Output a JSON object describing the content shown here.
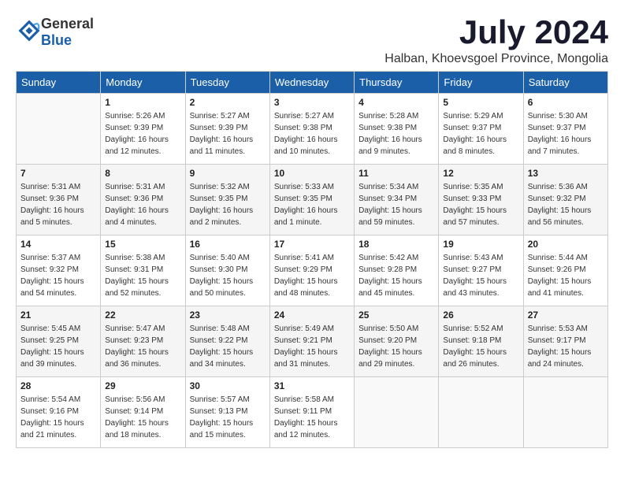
{
  "logo": {
    "general": "General",
    "blue": "Blue"
  },
  "title": "July 2024",
  "subtitle": "Halban, Khoevsgoel Province, Mongolia",
  "days_of_week": [
    "Sunday",
    "Monday",
    "Tuesday",
    "Wednesday",
    "Thursday",
    "Friday",
    "Saturday"
  ],
  "weeks": [
    [
      {
        "day": "",
        "info": ""
      },
      {
        "day": "1",
        "info": "Sunrise: 5:26 AM\nSunset: 9:39 PM\nDaylight: 16 hours\nand 12 minutes."
      },
      {
        "day": "2",
        "info": "Sunrise: 5:27 AM\nSunset: 9:39 PM\nDaylight: 16 hours\nand 11 minutes."
      },
      {
        "day": "3",
        "info": "Sunrise: 5:27 AM\nSunset: 9:38 PM\nDaylight: 16 hours\nand 10 minutes."
      },
      {
        "day": "4",
        "info": "Sunrise: 5:28 AM\nSunset: 9:38 PM\nDaylight: 16 hours\nand 9 minutes."
      },
      {
        "day": "5",
        "info": "Sunrise: 5:29 AM\nSunset: 9:37 PM\nDaylight: 16 hours\nand 8 minutes."
      },
      {
        "day": "6",
        "info": "Sunrise: 5:30 AM\nSunset: 9:37 PM\nDaylight: 16 hours\nand 7 minutes."
      }
    ],
    [
      {
        "day": "7",
        "info": "Sunrise: 5:31 AM\nSunset: 9:36 PM\nDaylight: 16 hours\nand 5 minutes."
      },
      {
        "day": "8",
        "info": "Sunrise: 5:31 AM\nSunset: 9:36 PM\nDaylight: 16 hours\nand 4 minutes."
      },
      {
        "day": "9",
        "info": "Sunrise: 5:32 AM\nSunset: 9:35 PM\nDaylight: 16 hours\nand 2 minutes."
      },
      {
        "day": "10",
        "info": "Sunrise: 5:33 AM\nSunset: 9:35 PM\nDaylight: 16 hours\nand 1 minute."
      },
      {
        "day": "11",
        "info": "Sunrise: 5:34 AM\nSunset: 9:34 PM\nDaylight: 15 hours\nand 59 minutes."
      },
      {
        "day": "12",
        "info": "Sunrise: 5:35 AM\nSunset: 9:33 PM\nDaylight: 15 hours\nand 57 minutes."
      },
      {
        "day": "13",
        "info": "Sunrise: 5:36 AM\nSunset: 9:32 PM\nDaylight: 15 hours\nand 56 minutes."
      }
    ],
    [
      {
        "day": "14",
        "info": "Sunrise: 5:37 AM\nSunset: 9:32 PM\nDaylight: 15 hours\nand 54 minutes."
      },
      {
        "day": "15",
        "info": "Sunrise: 5:38 AM\nSunset: 9:31 PM\nDaylight: 15 hours\nand 52 minutes."
      },
      {
        "day": "16",
        "info": "Sunrise: 5:40 AM\nSunset: 9:30 PM\nDaylight: 15 hours\nand 50 minutes."
      },
      {
        "day": "17",
        "info": "Sunrise: 5:41 AM\nSunset: 9:29 PM\nDaylight: 15 hours\nand 48 minutes."
      },
      {
        "day": "18",
        "info": "Sunrise: 5:42 AM\nSunset: 9:28 PM\nDaylight: 15 hours\nand 45 minutes."
      },
      {
        "day": "19",
        "info": "Sunrise: 5:43 AM\nSunset: 9:27 PM\nDaylight: 15 hours\nand 43 minutes."
      },
      {
        "day": "20",
        "info": "Sunrise: 5:44 AM\nSunset: 9:26 PM\nDaylight: 15 hours\nand 41 minutes."
      }
    ],
    [
      {
        "day": "21",
        "info": "Sunrise: 5:45 AM\nSunset: 9:25 PM\nDaylight: 15 hours\nand 39 minutes."
      },
      {
        "day": "22",
        "info": "Sunrise: 5:47 AM\nSunset: 9:23 PM\nDaylight: 15 hours\nand 36 minutes."
      },
      {
        "day": "23",
        "info": "Sunrise: 5:48 AM\nSunset: 9:22 PM\nDaylight: 15 hours\nand 34 minutes."
      },
      {
        "day": "24",
        "info": "Sunrise: 5:49 AM\nSunset: 9:21 PM\nDaylight: 15 hours\nand 31 minutes."
      },
      {
        "day": "25",
        "info": "Sunrise: 5:50 AM\nSunset: 9:20 PM\nDaylight: 15 hours\nand 29 minutes."
      },
      {
        "day": "26",
        "info": "Sunrise: 5:52 AM\nSunset: 9:18 PM\nDaylight: 15 hours\nand 26 minutes."
      },
      {
        "day": "27",
        "info": "Sunrise: 5:53 AM\nSunset: 9:17 PM\nDaylight: 15 hours\nand 24 minutes."
      }
    ],
    [
      {
        "day": "28",
        "info": "Sunrise: 5:54 AM\nSunset: 9:16 PM\nDaylight: 15 hours\nand 21 minutes."
      },
      {
        "day": "29",
        "info": "Sunrise: 5:56 AM\nSunset: 9:14 PM\nDaylight: 15 hours\nand 18 minutes."
      },
      {
        "day": "30",
        "info": "Sunrise: 5:57 AM\nSunset: 9:13 PM\nDaylight: 15 hours\nand 15 minutes."
      },
      {
        "day": "31",
        "info": "Sunrise: 5:58 AM\nSunset: 9:11 PM\nDaylight: 15 hours\nand 12 minutes."
      },
      {
        "day": "",
        "info": ""
      },
      {
        "day": "",
        "info": ""
      },
      {
        "day": "",
        "info": ""
      }
    ]
  ]
}
